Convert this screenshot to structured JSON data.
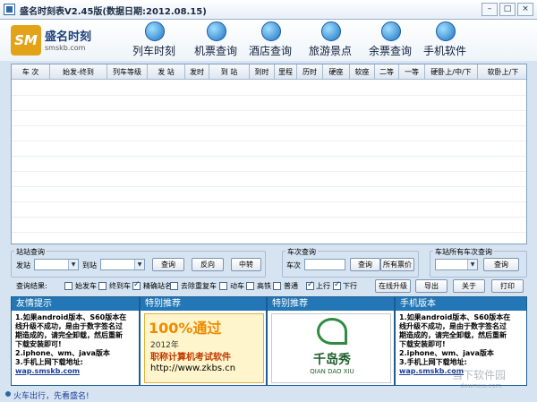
{
  "window": {
    "title": "盛名时刻表V2.45版(数据日期:2012.08.15)",
    "min": "–",
    "max": "□",
    "close": "×"
  },
  "logo": {
    "name": "盛名时刻",
    "url": "smskb.com",
    "mark": "SM"
  },
  "nav": [
    {
      "label": "列车时刻",
      "icon": "train-icon"
    },
    {
      "label": "机票查询",
      "icon": "plane-icon"
    },
    {
      "label": "酒店查询",
      "icon": "hotel-icon"
    },
    {
      "label": "旅游景点",
      "icon": "scenic-icon"
    },
    {
      "label": "余票查询",
      "icon": "ticket-icon"
    },
    {
      "label": "手机软件",
      "icon": "phone-icon"
    }
  ],
  "grid": {
    "columns": [
      "车  次",
      "始发-终到",
      "列车等级",
      "发  站",
      "发时",
      "到  站",
      "到时",
      "里程",
      "历时",
      "硬座",
      "软座",
      "二等",
      "一等",
      "硬卧上/中/下",
      "软卧上/下"
    ]
  },
  "station_query": {
    "title": "站站查询",
    "from_label": "发站",
    "to_label": "到站",
    "query_btn": "查询",
    "reverse_btn": "反向",
    "transfer_btn": "中转"
  },
  "train_query": {
    "title": "车次查询",
    "train_label": "车次",
    "query_btn": "查询",
    "price_btn": "所有票价"
  },
  "all_trains": {
    "title": "车站所有车次查询",
    "query_btn": "查询"
  },
  "filter": {
    "label": "查询结果:",
    "options": [
      {
        "label": "始发车",
        "checked": false
      },
      {
        "label": "终到车",
        "checked": false
      },
      {
        "label": "精确站名",
        "checked": true
      },
      {
        "label": "去除重复车",
        "checked": false
      },
      {
        "label": "动车",
        "checked": false
      },
      {
        "label": "高铁",
        "checked": false
      },
      {
        "label": "普通",
        "checked": false
      },
      {
        "label": "上行",
        "checked": true
      },
      {
        "label": "下行",
        "checked": true
      }
    ],
    "online_upgrade": "在线升级",
    "export": "导出",
    "about": "关于",
    "print": "打印"
  },
  "panels": {
    "tips_title": "友情提示",
    "ad1_title": "特别推荐",
    "ad2_title": "特别推荐",
    "mobile_title": "手机版本",
    "tips_lines": [
      "1.如果android版本、S60版本在",
      "线升级不成功，是由于数字签名过",
      "期造成的，请完全卸载，然后重新",
      "下载安装即可!",
      "2.iphone、wm、java版本",
      "3.手机上网下载地址:"
    ],
    "tips_link": "wap.smskb.com",
    "mobile_lines": [
      "1.如果android版本、S60版本在",
      "线升级不成功，是由于数字签名过",
      "期造成的，请完全卸载，然后重新",
      "下载安装即可!",
      "2.iphone、wm、java版本",
      "3.手机上网下载地址:"
    ],
    "mobile_link": "wap.smskb.com",
    "ad1": {
      "big": "100%通过",
      "year": "2012年",
      "text": "职称计算机考试软件",
      "url": "http://www.zkbs.cn"
    },
    "ad2": {
      "name": "千岛秀",
      "sub": "QIAN DAO XIU"
    }
  },
  "status": {
    "text": "火车出行，先看盛名!"
  },
  "watermark": {
    "text": "当下软件园",
    "sub": "downxia.com"
  }
}
